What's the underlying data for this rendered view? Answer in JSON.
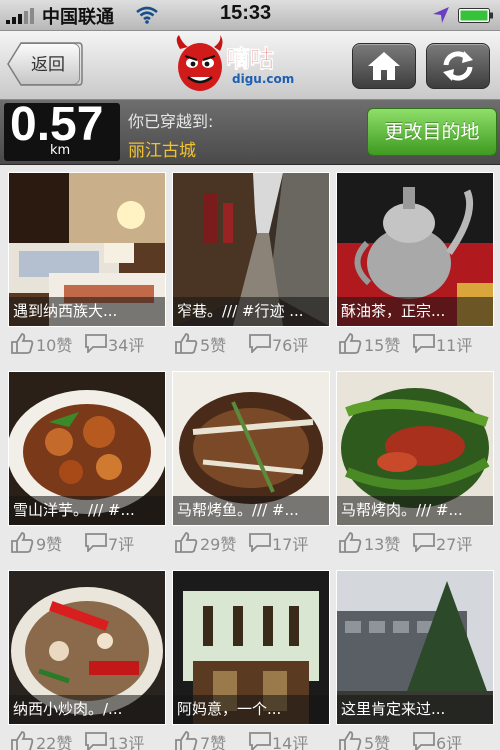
{
  "status_bar": {
    "carrier": "中国联通",
    "time": "15:33",
    "icons": [
      "signal-icon",
      "wifi-icon",
      "location-arrow-icon",
      "battery-icon"
    ]
  },
  "nav": {
    "back_label": "返回",
    "logo_text": "嘀咕",
    "logo_url": "digu.com",
    "icons": [
      "home-icon",
      "refresh-icon"
    ]
  },
  "distance": {
    "value": "0.57",
    "unit": "km",
    "label": "你已穿越到:",
    "destination": "丽江古城",
    "change_label": "更改目的地"
  },
  "colors": {
    "accent_green": "#4caf2c",
    "destination_yellow": "#f2c230"
  },
  "posts": [
    {
      "caption": "遇到纳西族大...",
      "likes": "10赞",
      "comments": "34评"
    },
    {
      "caption": "窄巷。/// #行迹 ...",
      "likes": "5赞",
      "comments": "76评"
    },
    {
      "caption": "酥油茶，正宗...",
      "likes": "15赞",
      "comments": "11评"
    },
    {
      "caption": "雪山洋芋。/// #...",
      "likes": "9赞",
      "comments": "7评"
    },
    {
      "caption": "马帮烤鱼。/// #...",
      "likes": "29赞",
      "comments": "17评"
    },
    {
      "caption": "马帮烤肉。/// #...",
      "likes": "13赞",
      "comments": "27评"
    },
    {
      "caption": "纳西小炒肉。/...",
      "likes": "22赞",
      "comments": "13评"
    },
    {
      "caption": "阿妈意，一个...",
      "likes": "7赞",
      "comments": "14评"
    },
    {
      "caption": "这里肯定来过...",
      "likes": "5赞",
      "comments": "6评"
    }
  ]
}
